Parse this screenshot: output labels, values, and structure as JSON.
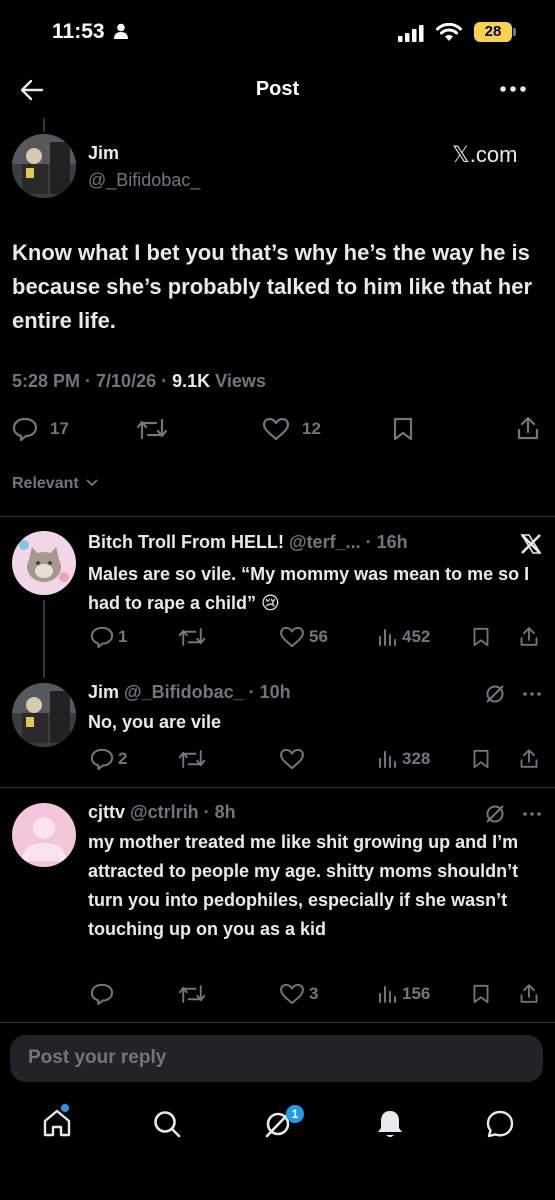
{
  "status_bar": {
    "time": "11:53",
    "battery": "28"
  },
  "nav": {
    "title": "Post"
  },
  "post": {
    "name": "Jim",
    "handle": "@_Bifidobac_",
    "source": "𝕏.com",
    "text": "Know what I bet you that’s why he’s the way he is because she’s probably talked to him like that her entire life.",
    "time": "5:28 PM",
    "date": "7/10/26",
    "views": "9.1K",
    "views_label": "Views",
    "replies": "17",
    "likes": "12"
  },
  "sort": {
    "label": "Relevant"
  },
  "replies": [
    {
      "name": "Bitch Troll From HELL!",
      "handle": "@terf_...",
      "age": "16h",
      "text": "Males are so vile. “My mommy was mean to me so I had to rape a child” 😢",
      "replies": "1",
      "retweets": "",
      "likes": "56",
      "views": "452"
    },
    {
      "name": "Jim",
      "handle": "@_Bifidobac_",
      "age": "10h",
      "text": "No, you are vile",
      "replies": "2",
      "retweets": "",
      "likes": "",
      "views": "328"
    },
    {
      "name": "cjttv",
      "handle": "@ctrlrih",
      "age": "8h",
      "text": "my mother treated me like shit growing up and I’m attracted to people my age. shitty moms shouldn’t turn you into pedophiles, especially if she wasn’t touching up on you as a kid",
      "replies": "",
      "retweets": "",
      "likes": "3",
      "views": "156"
    }
  ],
  "reply_bar": {
    "placeholder": "Post your reply"
  },
  "tab_bar": {
    "messages_badge": "1"
  }
}
